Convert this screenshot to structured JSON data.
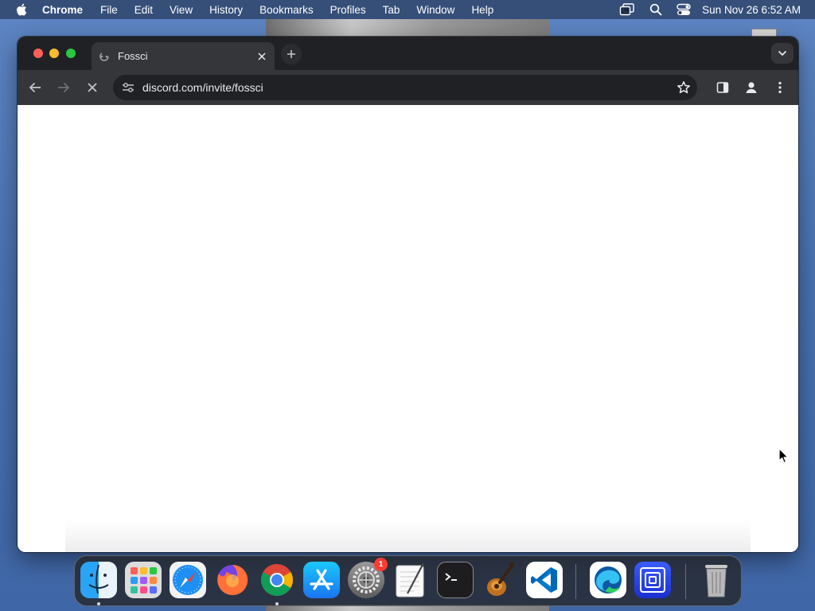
{
  "menubar": {
    "app_name": "Chrome",
    "items": [
      "File",
      "Edit",
      "View",
      "History",
      "Bookmarks",
      "Profiles",
      "Tab",
      "Window",
      "Help"
    ],
    "clock": "Sun Nov 26  6:52 AM"
  },
  "browser": {
    "tab": {
      "title": "Fossci"
    },
    "address": "discord.com/invite/fossci",
    "state": "loading"
  },
  "dock": {
    "apps": [
      {
        "name": "finder",
        "running": true
      },
      {
        "name": "launchpad",
        "running": false
      },
      {
        "name": "safari",
        "running": false
      },
      {
        "name": "firefox",
        "running": false
      },
      {
        "name": "chrome",
        "running": true
      },
      {
        "name": "app-store",
        "running": false
      },
      {
        "name": "system-settings",
        "running": false,
        "badge": "1"
      },
      {
        "name": "textedit",
        "running": false
      },
      {
        "name": "terminal",
        "running": false
      },
      {
        "name": "garageband",
        "running": false
      },
      {
        "name": "vscode",
        "running": false
      },
      {
        "name": "edge",
        "running": false
      },
      {
        "name": "screen-app",
        "running": false
      },
      {
        "name": "trash",
        "running": false
      }
    ]
  },
  "colors": {
    "tabstrip": "#202124",
    "toolbar": "#35363a",
    "omnibox": "#202124",
    "desktop": "#4a73b3"
  }
}
